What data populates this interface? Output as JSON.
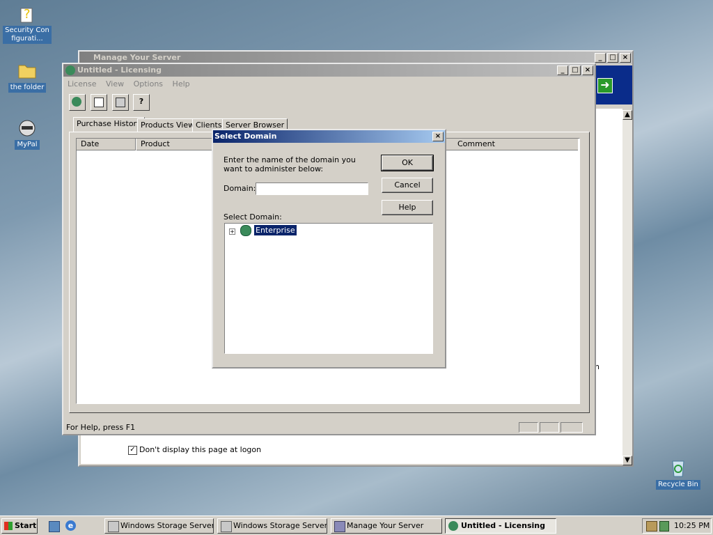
{
  "desktop": {
    "icons": [
      {
        "label": "Security Configurati...",
        "icon": "security-config-icon"
      },
      {
        "label": "the folder",
        "icon": "folder-icon"
      },
      {
        "label": "MyPal",
        "icon": "mypal-icon"
      },
      {
        "label": "Recycle Bin",
        "icon": "recycle-bin-icon"
      }
    ]
  },
  "manage_server": {
    "title": "Manage Your Server",
    "checkbox_label": "Don't display this page at logon",
    "checkbox_checked": true,
    "partial_text": "n"
  },
  "licensing": {
    "title": "Untitled - Licensing",
    "menu": [
      "License",
      "View",
      "Options",
      "Help"
    ],
    "tabs": [
      "Purchase History",
      "Products View",
      "Clients",
      "Server Browser"
    ],
    "columns": {
      "date": "Date",
      "product": "Product",
      "comment": "Comment"
    },
    "status": "For Help, press F1"
  },
  "dialog": {
    "title": "Select Domain",
    "instruction": "Enter the name of the domain you want to administer below:",
    "domain_label": "Domain:",
    "domain_value": "",
    "select_label": "Select Domain:",
    "tree_item": "Enterprise",
    "ok": "OK",
    "cancel": "Cancel",
    "help": "Help"
  },
  "taskbar": {
    "start": "Start",
    "tasks": [
      "Windows Storage Server...",
      "Windows Storage Server...",
      "Manage Your Server",
      "Untitled - Licensing"
    ],
    "clock": "10:25 PM"
  }
}
